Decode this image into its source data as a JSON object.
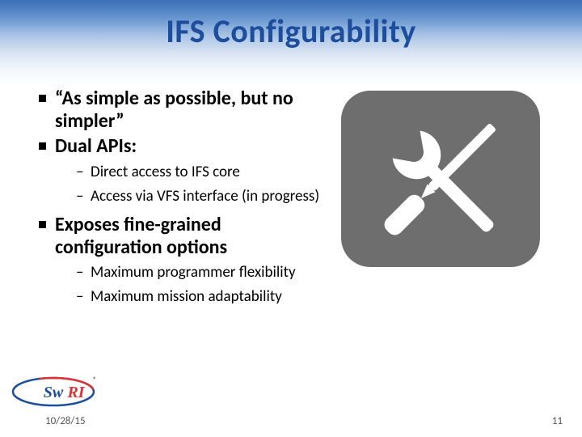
{
  "title": "IFS Configurability",
  "bullets": [
    {
      "text": "“As simple as possible, but no simpler”",
      "sub": []
    },
    {
      "text": "Dual APIs:",
      "sub": [
        "Direct access to IFS core",
        "Access via VFS interface (in progress)"
      ]
    },
    {
      "text": "Exposes fine-grained configuration options",
      "sub": [
        "Maximum programmer flexibility",
        "Maximum mission adaptability"
      ]
    }
  ],
  "footer": {
    "date": "10/28/15",
    "page": "11"
  },
  "logo_text": "SwRI",
  "colors": {
    "title": "#1d4e9e",
    "icon_bg": "#6e6e6e",
    "icon_fg": "#ffffff"
  }
}
